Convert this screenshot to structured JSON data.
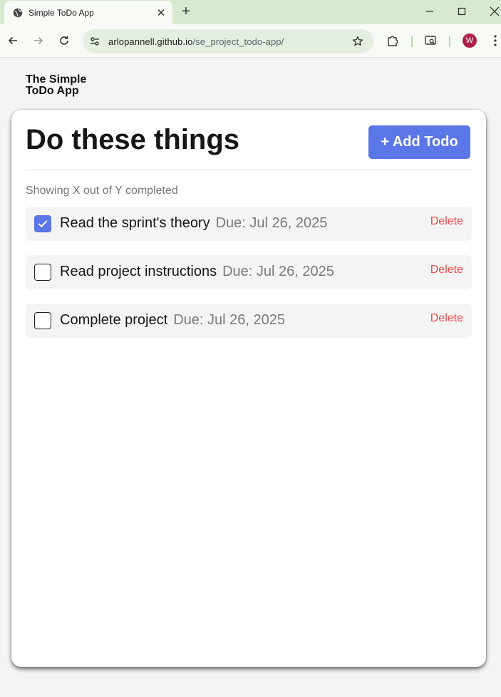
{
  "browser": {
    "tab_title": "Simple ToDo App",
    "url_host": "arlopannell.github.io",
    "url_path": "/se_project_todo-app/",
    "profile_initial": "W"
  },
  "page": {
    "logo": "The Simple ToDo App",
    "heading": "Do these things",
    "add_button": "+ Add Todo",
    "counter": "Showing X out of Y completed",
    "todos": [
      {
        "name": "Read the sprint's theory",
        "due": "Due: Jul 26, 2025",
        "completed": true,
        "delete_label": "Delete"
      },
      {
        "name": "Read project instructions",
        "due": "Due: Jul 26, 2025",
        "completed": false,
        "delete_label": "Delete"
      },
      {
        "name": "Complete project",
        "due": "Due: Jul 26, 2025",
        "completed": false,
        "delete_label": "Delete"
      }
    ]
  },
  "colors": {
    "accent": "#5b76e6",
    "delete": "#ef4a4a",
    "tabstrip": "#d8e9d0"
  }
}
